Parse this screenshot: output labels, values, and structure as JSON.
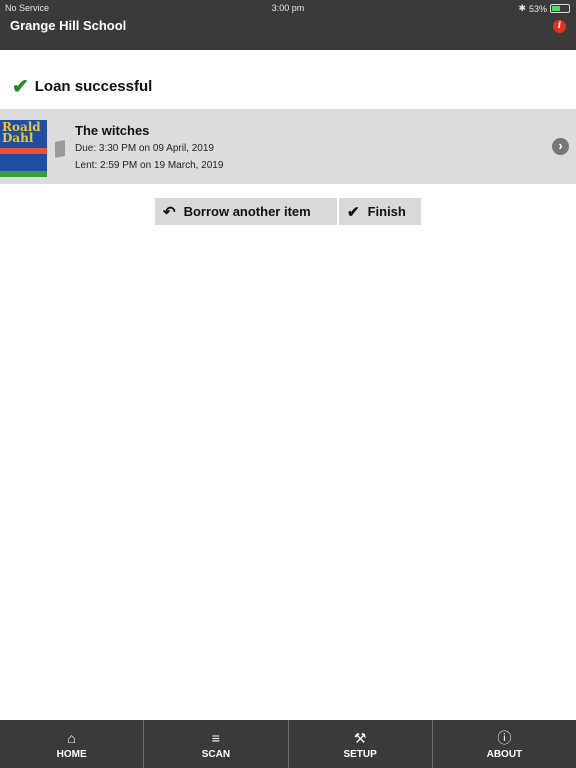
{
  "status_bar": {
    "carrier": "No Service",
    "time": "3:00 pm",
    "battery": "53%",
    "battery_level": 0.53
  },
  "header": {
    "title": "Grange Hill School"
  },
  "result": {
    "message": "Loan successful"
  },
  "loan_item": {
    "title": "The witches",
    "due": "Due: 3:30 PM on 09 April, 2019",
    "lent": "Lent: 2:59 PM on 19 March, 2019",
    "cover_author": "Roald Dahl"
  },
  "actions": {
    "borrow_label": "Borrow another item",
    "finish_label": "Finish"
  },
  "tabs": [
    {
      "label": "HOME",
      "icon": "home-icon"
    },
    {
      "label": "SCAN",
      "icon": "barcode-scan-icon"
    },
    {
      "label": "SETUP",
      "icon": "wrench-icon"
    },
    {
      "label": "ABOUT",
      "icon": "info-icon"
    }
  ],
  "colors": {
    "bar_background": "#3a3a3a",
    "success_green": "#1e8c1e",
    "alert_red": "#e0301e",
    "row_background": "#dcdcdc"
  }
}
